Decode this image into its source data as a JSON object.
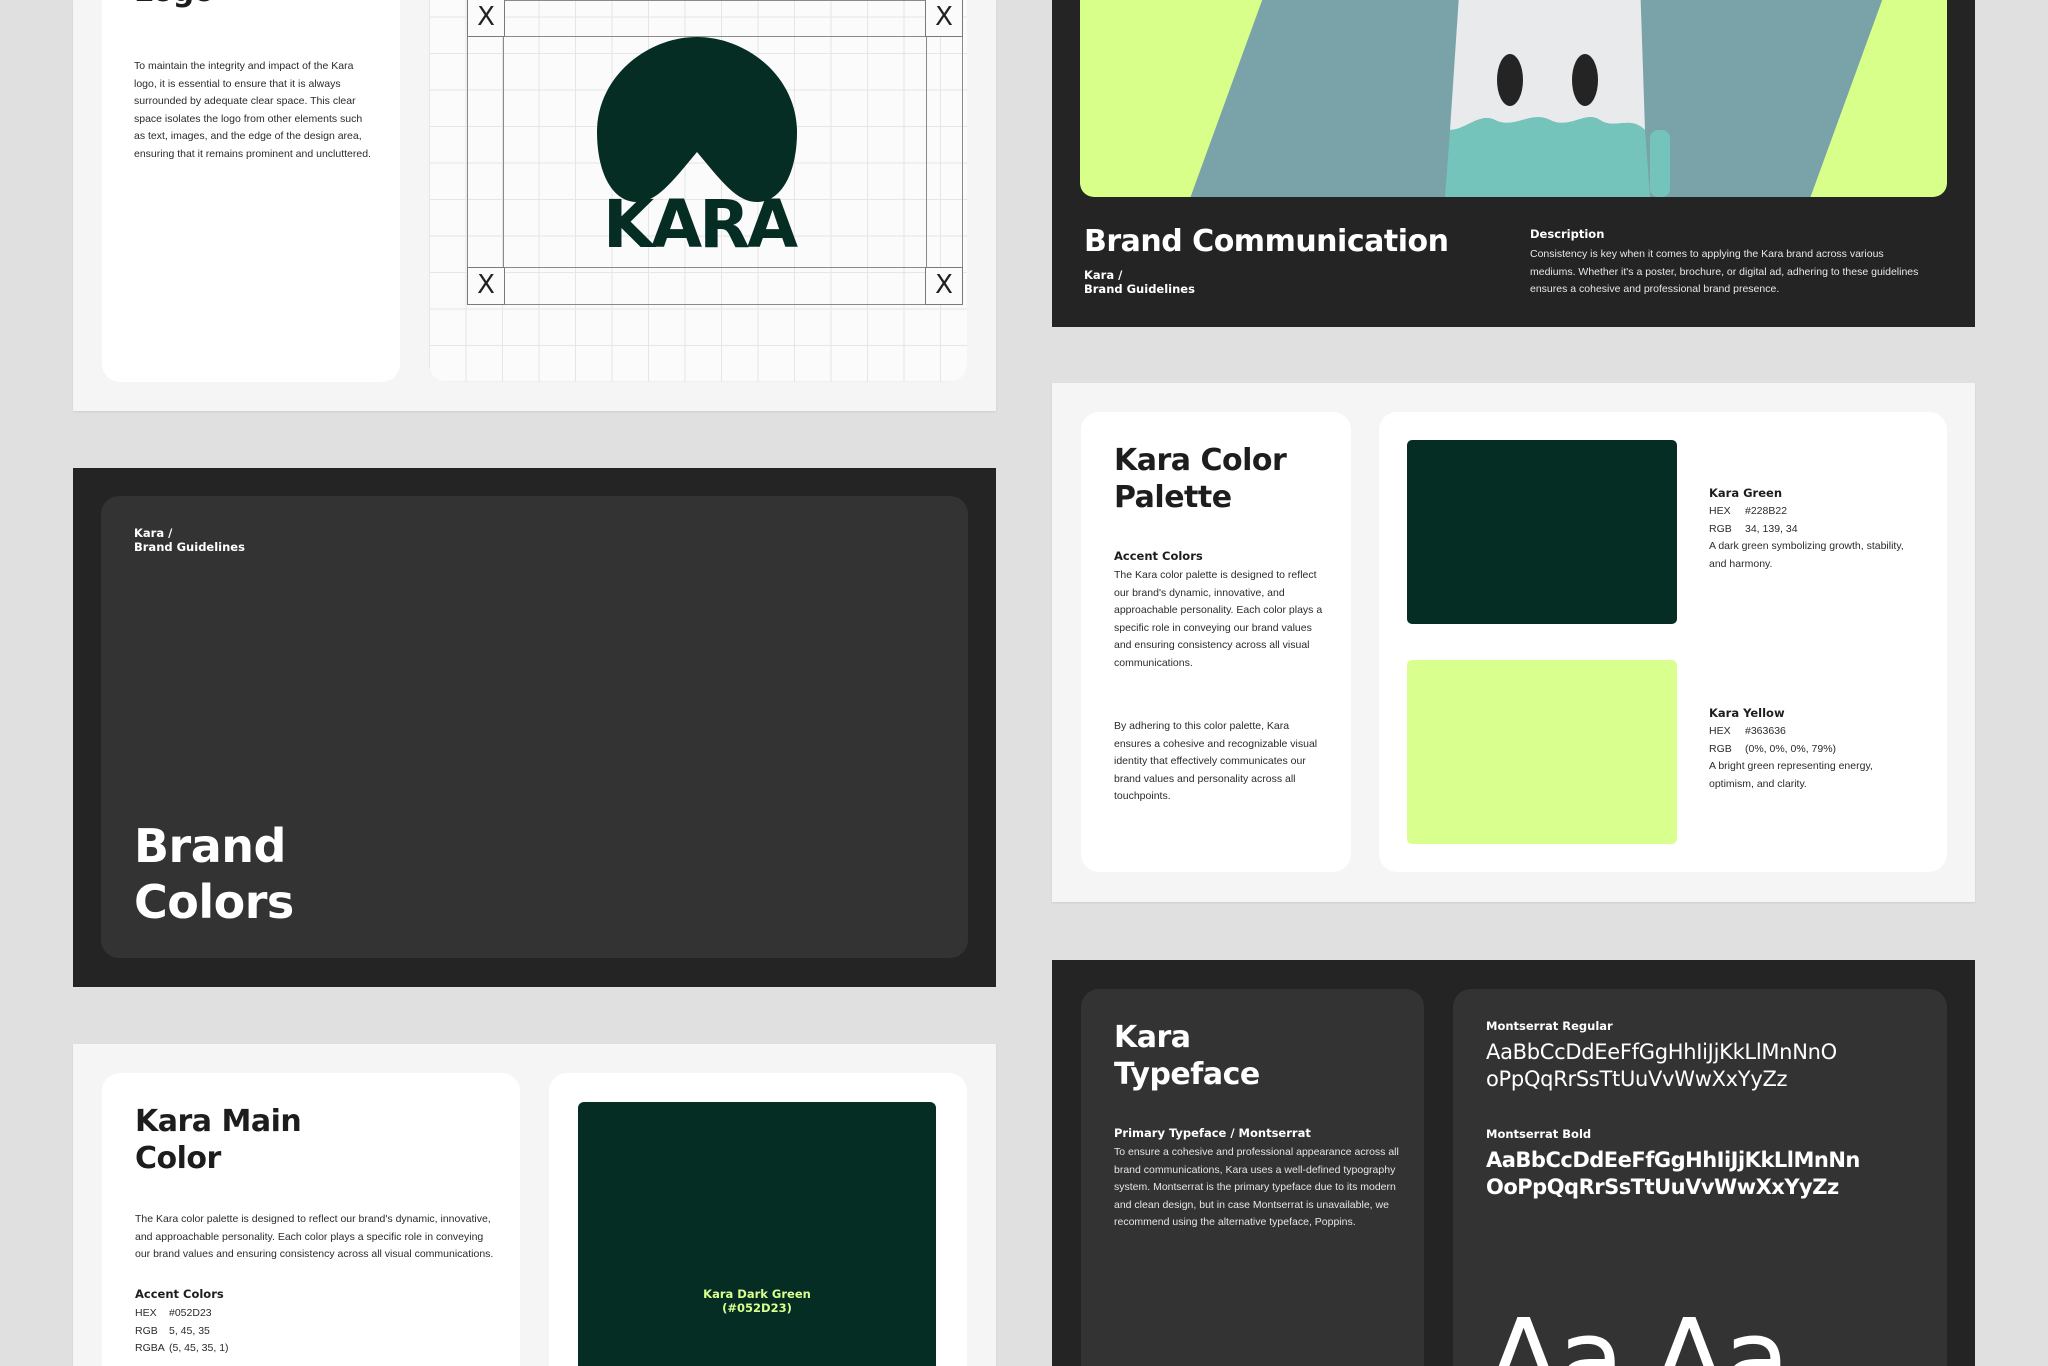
{
  "colors": {
    "background": "#e0e0e0",
    "kara_green": "#052D23",
    "kara_yellow": "#D9FF8F",
    "dark_slide": "#242424",
    "dark_card": "#333333"
  },
  "logo_slide": {
    "title": "Logo",
    "body": "To maintain the integrity and impact of the Kara logo, it is essential to ensure that it is always surrounded by adequate clear space. This clear space isolates the logo from other elements such as text, images, and the edge of the design area, ensuring that it remains prominent and uncluttered.",
    "wordmark": "KARA",
    "clearspace_mark": "X",
    "icons": [
      "mountain-logo-icon",
      "clear-space-x-icon"
    ]
  },
  "brand_communication": {
    "title": "Brand Communication",
    "breadcrumb_line1": "Kara /",
    "breadcrumb_line2": "Brand Guidelines",
    "description_label": "Description",
    "description": "Consistency is key when it comes to applying the Kara brand across various mediums. Whether it's a poster, brochure, or digital ad, adhering to these guidelines ensures a cohesive and professional brand presence."
  },
  "brand_colors_slide": {
    "breadcrumb_line1": "Kara /",
    "breadcrumb_line2": "Brand Guidelines",
    "title_line1": "Brand",
    "title_line2": "Colors"
  },
  "palette_slide": {
    "title": "Kara Color\nPalette",
    "accent_label": "Accent Colors",
    "para1": "The Kara color palette is designed to reflect our brand's dynamic, innovative, and approachable personality. Each color plays a specific role in conveying our brand values and ensuring consistency across all visual communications.",
    "para2": "By adhering to this color palette, Kara ensures a cohesive and recognizable visual identity that effectively communicates our brand values and personality across all touchpoints.",
    "swatches": [
      {
        "name": "Kara Green",
        "hex_label": "HEX",
        "hex": "#228B22",
        "rgb_label": "RGB",
        "rgb": "34, 139, 34",
        "desc": "A dark green symbolizing growth, stability, and harmony.",
        "color": "#052D23"
      },
      {
        "name": "Kara Yellow",
        "hex_label": "HEX",
        "hex": "#363636",
        "rgb_label": "RGB",
        "rgb": "(0%, 0%, 0%, 79%)",
        "desc": "A bright green representing energy, optimism, and clarity.",
        "color": "#D9FF8F"
      }
    ]
  },
  "main_color_slide": {
    "title": "Kara Main\nColor",
    "body": "The Kara color palette is designed to reflect our brand's dynamic, innovative, and approachable personality. Each color plays a specific role in conveying our brand values and ensuring consistency across all visual communications.",
    "accent_label": "Accent Colors",
    "rows": [
      {
        "k": "HEX",
        "v": "#052D23"
      },
      {
        "k": "RGB",
        "v": "5, 45, 35"
      },
      {
        "k": "RGBA",
        "v": "(5, 45, 35, 1)"
      }
    ],
    "swatch_label": "Kara Dark Green\n(#052D23)"
  },
  "typeface_slide": {
    "title": "Kara\nTypeface",
    "primary_label": "Primary Typeface / Montserrat",
    "body": "To ensure a cohesive and professional appearance across all brand communications, Kara uses a well-defined typography system. Montserrat is the primary typeface due to its modern and clean design, but in case Montserrat is unavailable, we recommend using the alternative typeface, Poppins.",
    "regular_label": "Montserrat Regular",
    "regular_sample": "AaBbCcDdEeFfGgHhIiJjKkLlMnNnO\noPpQqRrSsTtUuVvWwXxYyZz",
    "bold_label": "Montserrat Bold",
    "bold_sample": "AaBbCcDdEeFfGgHhIiJjKkLlMnNn\nOoPpQqRrSsTtUuVvWwXxYyZz",
    "big_sample": "Aa Aa"
  }
}
